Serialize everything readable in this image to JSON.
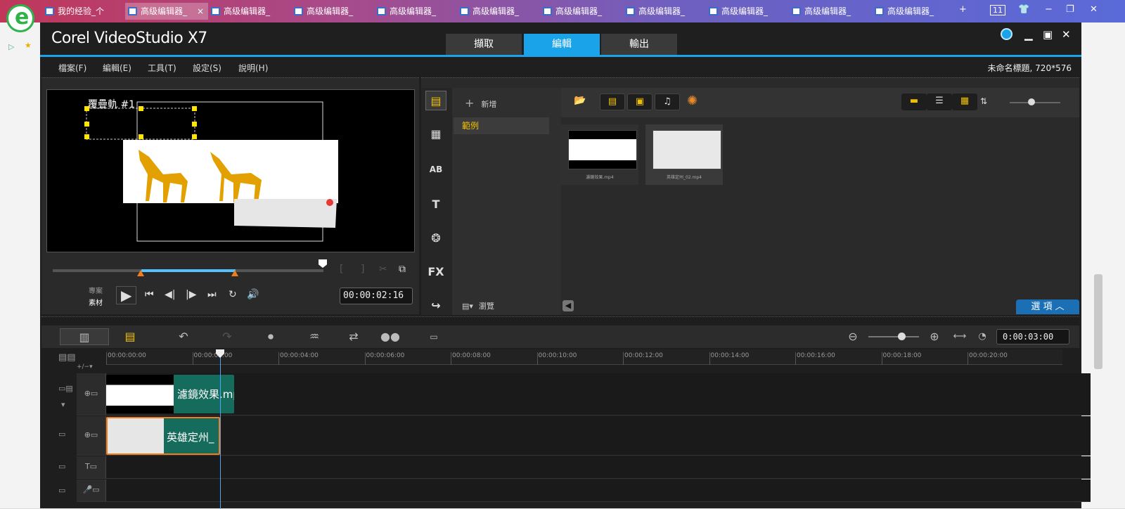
{
  "browser": {
    "tabs": [
      {
        "label": "我的经验_个",
        "active": false
      },
      {
        "label": "高级编辑器_",
        "active": true
      },
      {
        "label": "高级编辑器_",
        "active": false
      },
      {
        "label": "高级编辑器_",
        "active": false
      },
      {
        "label": "高级编辑器_",
        "active": false
      },
      {
        "label": "高级编辑器_",
        "active": false
      },
      {
        "label": "高级编辑器_",
        "active": false
      },
      {
        "label": "高级编辑器_",
        "active": false
      },
      {
        "label": "高级编辑器_",
        "active": false
      },
      {
        "label": "高级编辑器_",
        "active": false
      },
      {
        "label": "高级编辑器_",
        "active": false
      }
    ],
    "tab_close": "×",
    "new_tab": "+",
    "tab_count": "11",
    "controls": {
      "min": "−",
      "restore": "❐",
      "close": "✕"
    }
  },
  "app": {
    "title": "Corel VideoStudio X7",
    "modes": [
      "擷取",
      "編輯",
      "輸出"
    ],
    "active_mode": "編輯",
    "menu": [
      "檔案(F)",
      "編輯(E)",
      "工具(T)",
      "設定(S)",
      "說明(H)"
    ],
    "project_info": "未命名標題, 720*576",
    "window_controls": {
      "min": "▁",
      "max": "▣",
      "close": "✕"
    }
  },
  "player": {
    "overlay_label": "覆疊軌 #1",
    "mode_project": "專案",
    "mode_clip": "素材",
    "timecode": "00:00:02:16",
    "buttons": {
      "play": "▶",
      "start": "⏮",
      "prev": "◀|",
      "next": "|▶",
      "end": "⏭",
      "repeat": "↻",
      "volume": "🔊"
    }
  },
  "library": {
    "add_label": "新增",
    "folder": "範例",
    "browse_label": "瀏覽",
    "options_label": "選 項",
    "media": [
      {
        "name": "濾鏡效果.mp4"
      },
      {
        "name": "英雄定州_02.mp4"
      }
    ],
    "tools": [
      "▤",
      "▦",
      "AB",
      "T",
      "❂",
      "FX",
      "↪"
    ]
  },
  "timeline": {
    "time_display": "0:00:03:00",
    "ruler": [
      "00:00:00:00",
      "00:00:02:00",
      "00:00:04:00",
      "00:00:06:00",
      "00:00:08:00",
      "00:00:10:00",
      "00:00:12:00",
      "00:00:14:00",
      "00:00:16:00",
      "00:00:18:00",
      "00:00:20:00"
    ],
    "clips": [
      {
        "label": "濾鏡效果.mp"
      },
      {
        "label": "英雄定州_"
      }
    ],
    "add_track": "+/−▾"
  },
  "colors": {
    "accent": "#1aa3e8",
    "clip_green": "#156b5c",
    "highlight": "#f0c000",
    "selection_orange": "#f07c1a"
  }
}
